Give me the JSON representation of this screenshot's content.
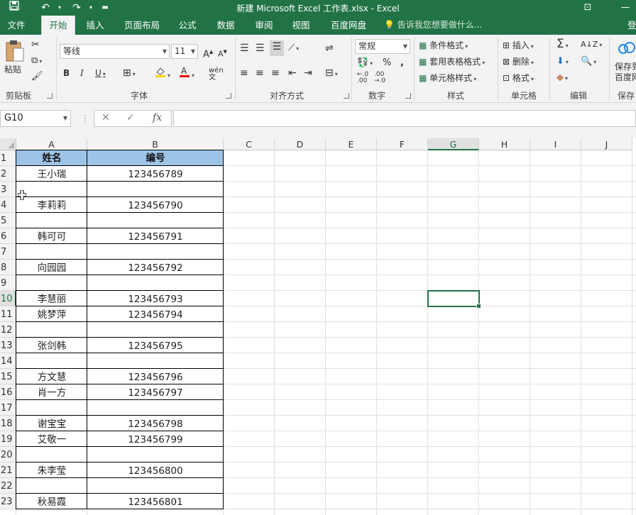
{
  "window": {
    "title": "新建 Microsoft Excel 工作表.xlsx - Excel"
  },
  "tabs": [
    "文件",
    "开始",
    "插入",
    "页面布局",
    "公式",
    "数据",
    "审阅",
    "视图",
    "百度网盘"
  ],
  "active_tab": "开始",
  "tell_me": "告诉我您想要做什么...",
  "login_label": "登",
  "ribbon": {
    "clipboard": {
      "paste": "粘贴",
      "label": "剪贴板"
    },
    "font": {
      "name": "等线",
      "size": "11",
      "label": "字体",
      "bold": "B",
      "italic": "I",
      "underline": "U"
    },
    "alignment": {
      "label": "对齐方式"
    },
    "number": {
      "format": "常规",
      "label": "数字"
    },
    "styles": {
      "conditional": "条件格式",
      "table": "套用表格格式",
      "cell": "单元格样式",
      "label": "样式"
    },
    "cells": {
      "insert": "插入",
      "delete": "删除",
      "format": "格式",
      "label": "单元格"
    },
    "editing": {
      "label": "编辑"
    },
    "save": {
      "line1": "保存到",
      "line2": "百度网",
      "label": "保存"
    }
  },
  "formula_bar": {
    "name_box": "G10",
    "fx": "fx",
    "formula": ""
  },
  "columns": [
    "A",
    "B",
    "C",
    "D",
    "E",
    "F",
    "G",
    "H",
    "I",
    "J"
  ],
  "rows": [
    "1",
    "2",
    "3",
    "4",
    "5",
    "6",
    "7",
    "8",
    "9",
    "10",
    "11",
    "12",
    "13",
    "14",
    "15",
    "16",
    "17",
    "18",
    "19",
    "20",
    "21",
    "22",
    "23"
  ],
  "selected_cell": "G10",
  "table": {
    "headers": [
      "姓名",
      "编号"
    ],
    "rows": [
      [
        "王小瑞",
        "123456789"
      ],
      [
        "",
        ""
      ],
      [
        "李莉莉",
        "123456790"
      ],
      [
        "",
        ""
      ],
      [
        "韩可可",
        "123456791"
      ],
      [
        "",
        ""
      ],
      [
        "向园园",
        "123456792"
      ],
      [
        "",
        ""
      ],
      [
        "李慧丽",
        "123456793"
      ],
      [
        "姚梦萍",
        "123456794"
      ],
      [
        "",
        ""
      ],
      [
        "张剑韩",
        "123456795"
      ],
      [
        "",
        ""
      ],
      [
        "方文慧",
        "123456796"
      ],
      [
        "肖一方",
        "123456797"
      ],
      [
        "",
        ""
      ],
      [
        "谢宝宝",
        "123456798"
      ],
      [
        "艾敬一",
        "123456799"
      ],
      [
        "",
        ""
      ],
      [
        "朱李莹",
        "123456800"
      ],
      [
        "",
        ""
      ],
      [
        "秋易霞",
        "123456801"
      ]
    ]
  },
  "colors": {
    "excel_green": "#217346",
    "header_fill": "#9dc3e6"
  }
}
